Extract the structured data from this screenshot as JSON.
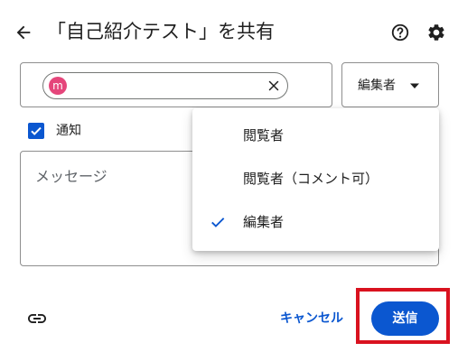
{
  "dialog": {
    "title": "「自己紹介テスト」を共有",
    "back_icon": "arrow-back-icon",
    "help_icon": "help-icon",
    "settings_icon": "gear-icon"
  },
  "recipient": {
    "chip_initial": "m",
    "chip_color": "#e5467b",
    "remove_icon": "close-icon"
  },
  "role_select": {
    "selected": "編集者"
  },
  "notify": {
    "label": "通知",
    "checked": true
  },
  "message": {
    "placeholder": "メッセージ"
  },
  "role_menu": {
    "items": [
      {
        "label": "閲覧者",
        "selected": false
      },
      {
        "label": "閲覧者（コメント可）",
        "selected": false
      },
      {
        "label": "編集者",
        "selected": true
      }
    ]
  },
  "footer": {
    "copy_link_icon": "link-icon",
    "cancel_label": "キャンセル",
    "send_label": "送信"
  },
  "colors": {
    "accent": "#0b57d0",
    "highlight": "#d9121f"
  }
}
